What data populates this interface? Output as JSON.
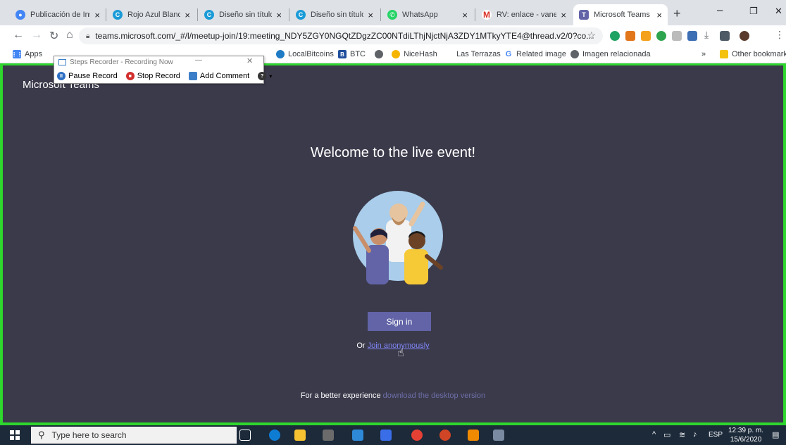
{
  "tabs": [
    {
      "title": "Publicación de Ins",
      "icon": "chrome-icon"
    },
    {
      "title": "Rojo Azul Blanco (",
      "icon": "canva-icon"
    },
    {
      "title": "Diseño sin título -",
      "icon": "canva-icon"
    },
    {
      "title": "Diseño sin título -",
      "icon": "canva-icon"
    },
    {
      "title": "WhatsApp",
      "icon": "whatsapp-icon"
    },
    {
      "title": "RV: enlace - vanes",
      "icon": "gmail-icon"
    },
    {
      "title": "Microsoft Teams",
      "icon": "teams-icon",
      "active": true
    }
  ],
  "tab_close": "×",
  "new_tab": "+",
  "window_controls": {
    "minimize": "–",
    "restore": "❐",
    "close": "✕"
  },
  "address_bar": {
    "url": "teams.microsoft.com/_#/l/meetup-join/19:meeting_NDY5ZGY0NGQtZDgzZC00NTdiLThjNjctNjA3ZDY1MTkyYTE4@thread.v2/0?co..."
  },
  "bookmarks": {
    "apps": "Apps",
    "items": [
      "LocalBitcoins",
      "BTC",
      "",
      "NiceHash",
      "Las Terrazas",
      "Related image",
      "Imagen relacionada"
    ],
    "overflow": "»",
    "other": "Other bookmarks"
  },
  "steps_recorder": {
    "title": "Steps Recorder - Recording Now",
    "minimize": "—",
    "close": "✕",
    "pause": "Pause Record",
    "stop": "Stop Record",
    "comment": "Add Comment",
    "help": "?"
  },
  "teams": {
    "brand": "Microsoft Teams",
    "welcome": "Welcome to the live event!",
    "sign_in": "Sign in",
    "or": "Or",
    "join_anon": "Join anonymously",
    "better": "For a better experience",
    "download": "download the desktop version"
  },
  "taskbar": {
    "search_placeholder": "Type here to search",
    "language": "ESP",
    "time": "12:39 p. m.",
    "date": "15/6/2020"
  },
  "colors": {
    "teams_bg": "#3b3a4b",
    "teams_accent": "#6264a7",
    "highlight_border": "#2ed62e",
    "taskbar": "#1c2a3a"
  }
}
